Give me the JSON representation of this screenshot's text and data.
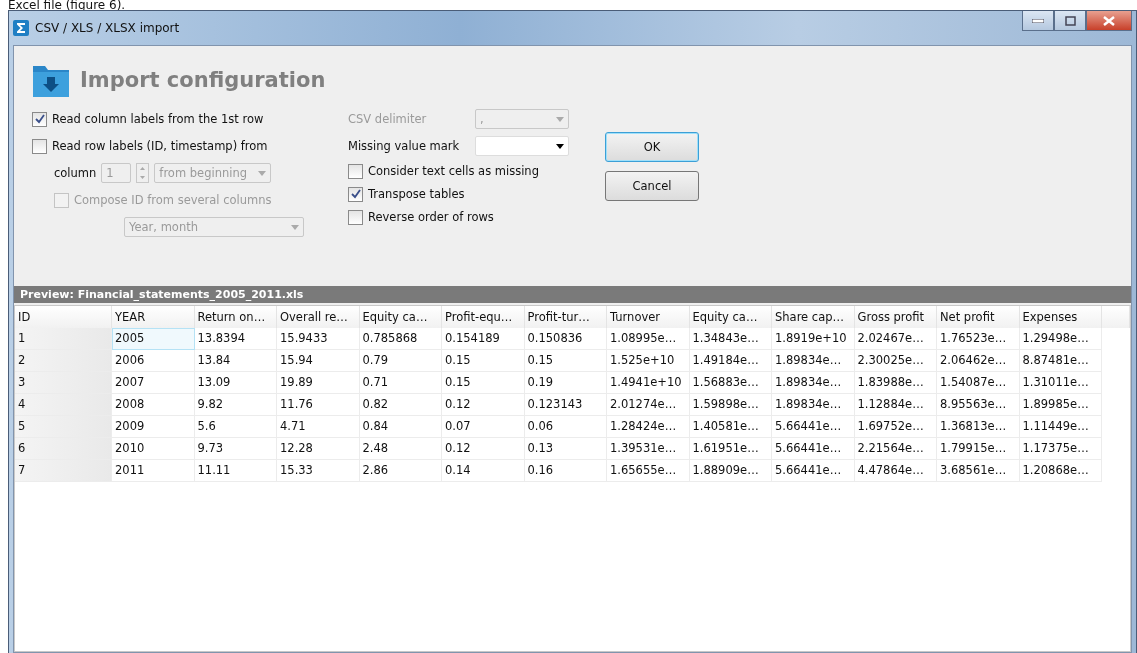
{
  "caption": "Excel file (figure 6).",
  "window": {
    "title": "CSV / XLS / XLSX import"
  },
  "header": {
    "title": "Import configuration"
  },
  "left_options": [
    {
      "kind": "checkbox",
      "label": "Read column labels from the 1st row",
      "checked": true,
      "disabled": false
    },
    {
      "kind": "checkbox",
      "label": "Read row labels (ID, timestamp) from",
      "checked": false,
      "disabled": false
    },
    {
      "kind": "column",
      "label": "column",
      "value": "1",
      "mode": "from beginning",
      "disabled": true
    },
    {
      "kind": "checkbox",
      "label": "Compose ID from several columns",
      "checked": false,
      "disabled": true
    },
    {
      "kind": "select",
      "value": "Year, month",
      "disabled": true
    }
  ],
  "csv_delimiter": {
    "label": "CSV delimiter",
    "value": ",",
    "disabled": true
  },
  "missing_value": {
    "label": "Missing value mark",
    "disabled": false
  },
  "right_options": [
    {
      "label": "Consider text cells as missing",
      "checked": false
    },
    {
      "label": "Transpose tables",
      "checked": true
    },
    {
      "label": "Reverse order of rows",
      "checked": false
    }
  ],
  "buttons": [
    {
      "label": "OK",
      "default": true
    },
    {
      "label": "Cancel",
      "default": false
    }
  ],
  "preview": {
    "title": "Preview: Financial_statements_2005_2011.xls",
    "columns": [
      "ID",
      "YEAR",
      "Return on…",
      "Overall re…",
      "Equity ca…",
      "Profit-equ…",
      "Profit-tur…",
      "Turnover",
      "Equity ca…",
      "Share cap…",
      "Gross profit",
      "Net profit",
      "Expenses"
    ],
    "rows": [
      {
        "selected": true,
        "cells": [
          "1",
          "2005",
          "13.8394",
          "15.9433",
          "0.785868",
          "0.154189",
          "0.150836",
          "1.08995e…",
          "1.34843e…",
          "1.8919e+10",
          "2.02467e…",
          "1.76523e…",
          "1.29498e…"
        ]
      },
      {
        "selected": false,
        "cells": [
          "2",
          "2006",
          "13.84",
          "15.94",
          "0.79",
          "0.15",
          "0.15",
          "1.525e+10",
          "1.49184e…",
          "1.89834e…",
          "2.30025e…",
          "2.06462e…",
          "8.87481e…"
        ]
      },
      {
        "selected": false,
        "cells": [
          "3",
          "2007",
          "13.09",
          "19.89",
          "0.71",
          "0.15",
          "0.19",
          "1.4941e+10",
          "1.56883e…",
          "1.89834e…",
          "1.83988e…",
          "1.54087e…",
          "1.31011e…"
        ]
      },
      {
        "selected": false,
        "cells": [
          "4",
          "2008",
          "9.82",
          "11.76",
          "0.82",
          "0.12",
          "0.123143",
          "2.01274e…",
          "1.59898e…",
          "1.89834e…",
          "1.12884e…",
          "8.95563e…",
          "1.89985e…"
        ]
      },
      {
        "selected": false,
        "cells": [
          "5",
          "2009",
          "5.6",
          "4.71",
          "0.84",
          "0.07",
          "0.06",
          "1.28424e…",
          "1.40581e…",
          "5.66441e…",
          "1.69752e…",
          "1.36813e…",
          "1.11449e…"
        ]
      },
      {
        "selected": false,
        "cells": [
          "6",
          "2010",
          "9.73",
          "12.28",
          "2.48",
          "0.12",
          "0.13",
          "1.39531e…",
          "1.61951e…",
          "5.66441e…",
          "2.21564e…",
          "1.79915e…",
          "1.17375e…"
        ]
      },
      {
        "selected": false,
        "cells": [
          "7",
          "2011",
          "11.11",
          "15.33",
          "2.86",
          "0.14",
          "0.16",
          "1.65655e…",
          "1.88909e…",
          "5.66441e…",
          "4.47864e…",
          "3.68561e…",
          "1.20868e…"
        ]
      }
    ]
  }
}
